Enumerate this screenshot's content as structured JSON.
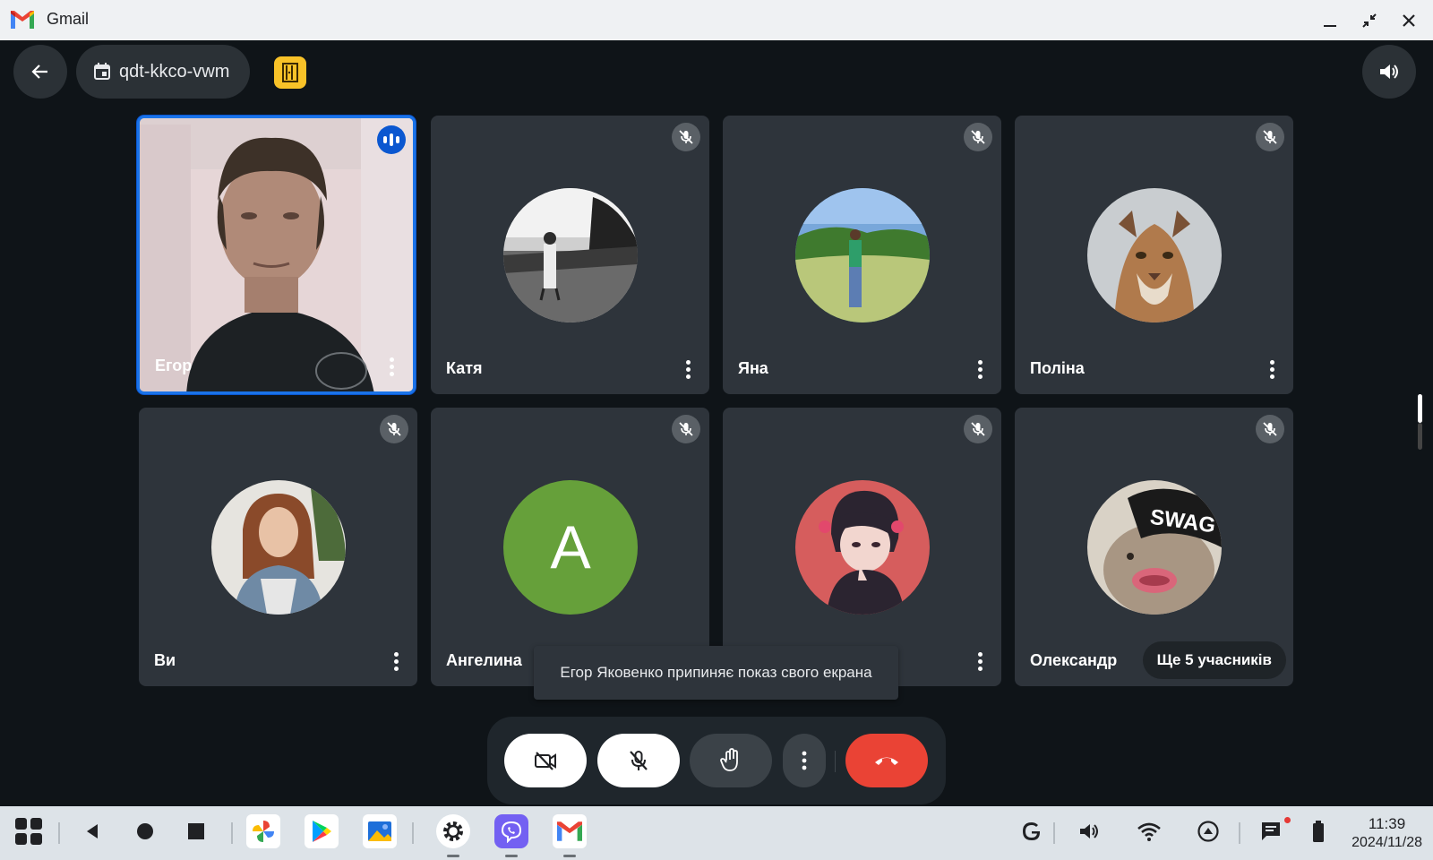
{
  "window": {
    "title": "Gmail"
  },
  "meeting": {
    "code": "qdt-kkco-vwm",
    "tiles": [
      {
        "name": "Егор",
        "kind": "video",
        "speaking": true
      },
      {
        "name": "Катя",
        "kind": "photo-bw",
        "muted": true
      },
      {
        "name": "Яна",
        "kind": "photo-nature",
        "muted": true
      },
      {
        "name": "Поліна",
        "kind": "photo-cougar",
        "muted": true
      },
      {
        "name": "Ви",
        "kind": "photo-woman",
        "muted": true
      },
      {
        "name": "Ангелина",
        "kind": "letter",
        "letter": "A",
        "muted": true
      },
      {
        "name": "",
        "kind": "photo-cartoon",
        "muted": true
      },
      {
        "name": "Олександр",
        "kind": "photo-swag",
        "muted": true,
        "swag_text": "SWAG"
      }
    ],
    "more_participants": "Ще 5 учасників",
    "toast": "Егор Яковенко припиняє показ свого екрана"
  },
  "controls": [
    "camera-off",
    "mic-off",
    "raise-hand",
    "more-options",
    "end-call"
  ],
  "taskbar": {
    "time": "11:39",
    "date": "2024/11/28",
    "apps": [
      "photos",
      "play-store",
      "files",
      "settings",
      "viber",
      "gmail"
    ],
    "tray": [
      "google",
      "volume",
      "wifi",
      "cast",
      "messages",
      "battery"
    ]
  },
  "colors": {
    "accent": "#1a73e8",
    "end_call": "#ea4335",
    "avatar_green": "#66a03a",
    "badge_yellow": "#f8c228"
  }
}
